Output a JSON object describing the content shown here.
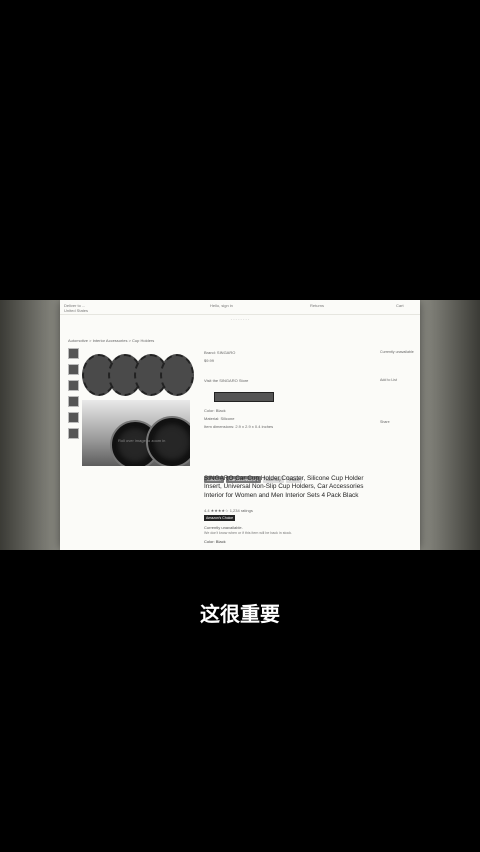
{
  "topbar": {
    "deliver": "Deliver to ...",
    "address": "United States",
    "links": [
      "Hello, sign in",
      "Returns",
      "Cart"
    ]
  },
  "breadcrumb": "Automotive > Interior Accessories > Cup Holders",
  "gallery_caption": "Roll over image to zoom in",
  "details": {
    "brand_line": "Brand: SINGARO",
    "price_line": "$9.99",
    "store_line": "Visit the SINGARO Store",
    "meta_lines": [
      "Color: Black",
      "Material: Silicone",
      "Item dimensions: 2.9 x 2.9 x 0.4 inches"
    ]
  },
  "tags": [
    "Coaster",
    "Car Accessories",
    "Non-Slip",
    "Insert"
  ],
  "product": {
    "title": "SINGARO Car Cup Holder Coaster, Silicone Cup Holder Insert, Universal Non-Slip Cup Holders, Car Accessories Interior for Women and Men Interior Sets 4 Pack Black",
    "rating": "4.4 ★★★★☆  1,234 ratings",
    "badge": "Amazon's Choice",
    "availability": "Currently unavailable.",
    "availability_hint": "We don't know when or if this item will be back in stock.",
    "color_label": "Color: Black"
  },
  "sidebar": {
    "lines": [
      "Currently unavailable",
      "Add to List",
      "Share"
    ]
  },
  "subtitle": "这很重要"
}
